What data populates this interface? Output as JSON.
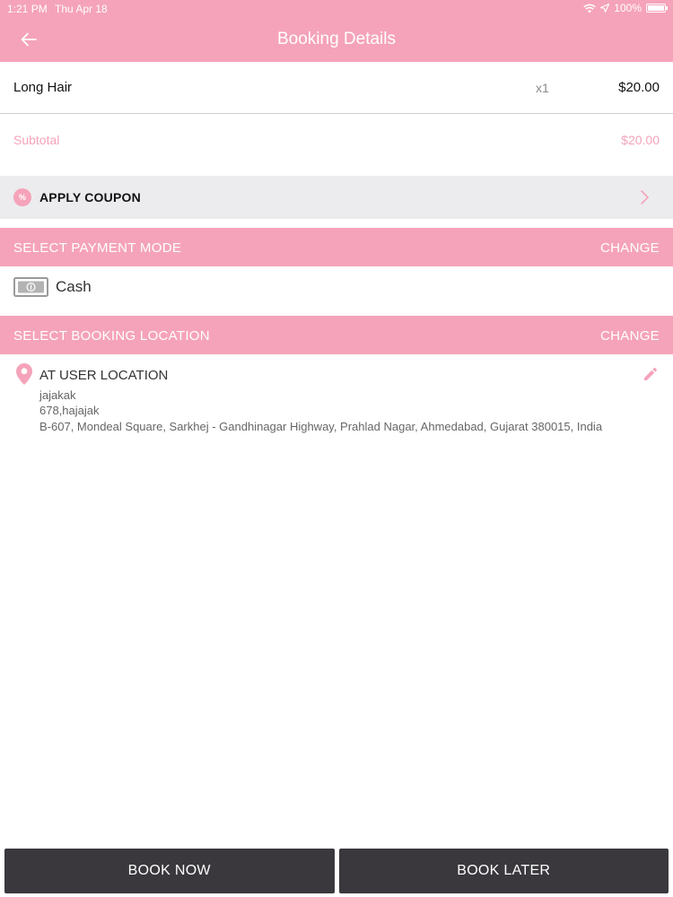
{
  "status_bar": {
    "time": "1:21 PM",
    "date": "Thu Apr 18",
    "battery": "100%"
  },
  "nav": {
    "title": "Booking Details"
  },
  "booking_item": {
    "name": "Long Hair",
    "quantity": "x1",
    "price": "$20.00"
  },
  "subtotal": {
    "label": "Subtotal",
    "value": "$20.00"
  },
  "coupon": {
    "icon_text": "%",
    "label": "APPLY COUPON"
  },
  "payment": {
    "header": "SELECT PAYMENT MODE",
    "change_label": "CHANGE",
    "method": "Cash"
  },
  "location": {
    "header": "SELECT BOOKING LOCATION",
    "change_label": "CHANGE",
    "type": "AT USER LOCATION",
    "name": "jajakak",
    "house": "678,hajajak",
    "address": "B-607,  Mondeal Square,  Sarkhej - Gandhinagar Highway,  Prahlad Nagar,  Ahmedabad,  Gujarat 380015,  India"
  },
  "actions": {
    "book_now": "BOOK NOW",
    "book_later": "BOOK LATER"
  },
  "colors": {
    "accent": "#f5a3ba",
    "button": "#3a383d",
    "coupon_bg": "#ececef"
  },
  "icons": [
    "back-arrow-icon",
    "wifi-icon",
    "location-arrow-icon",
    "battery-icon",
    "coupon-percent-icon",
    "chevron-right-icon",
    "cash-icon",
    "location-pin-icon",
    "edit-pencil-icon"
  ]
}
